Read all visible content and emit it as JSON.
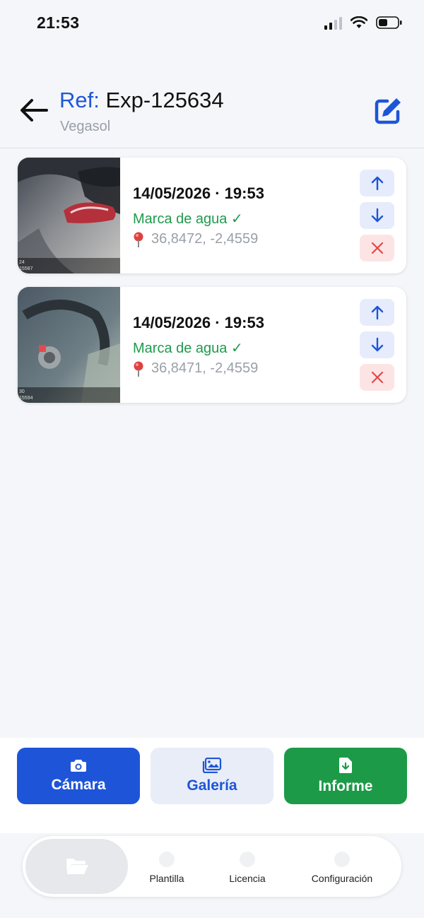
{
  "status_bar": {
    "time": "21:53"
  },
  "header": {
    "ref_label": "Ref:",
    "ref_value": " Exp-125634",
    "subtitle": "Vegasol"
  },
  "photos": [
    {
      "date": "14/05/2026 · 19:53",
      "watermark": "Marca de agua ✓",
      "coords": "36,8472, -2,4559",
      "thumb_caption_1": "24",
      "thumb_caption_2": "15587"
    },
    {
      "date": "14/05/2026 · 19:53",
      "watermark": "Marca de agua ✓",
      "coords": "36,8471, -2,4559",
      "thumb_caption_1": "30",
      "thumb_caption_2": "15594"
    }
  ],
  "actions": {
    "camera": "Cámara",
    "gallery": "Galería",
    "report": "Informe"
  },
  "tabs": {
    "template": "Plantilla",
    "license": "Licencia",
    "settings": "Configuración"
  },
  "colors": {
    "accent_blue": "#1e55d8",
    "success_green": "#1d9a48",
    "danger_red": "#e04848"
  }
}
